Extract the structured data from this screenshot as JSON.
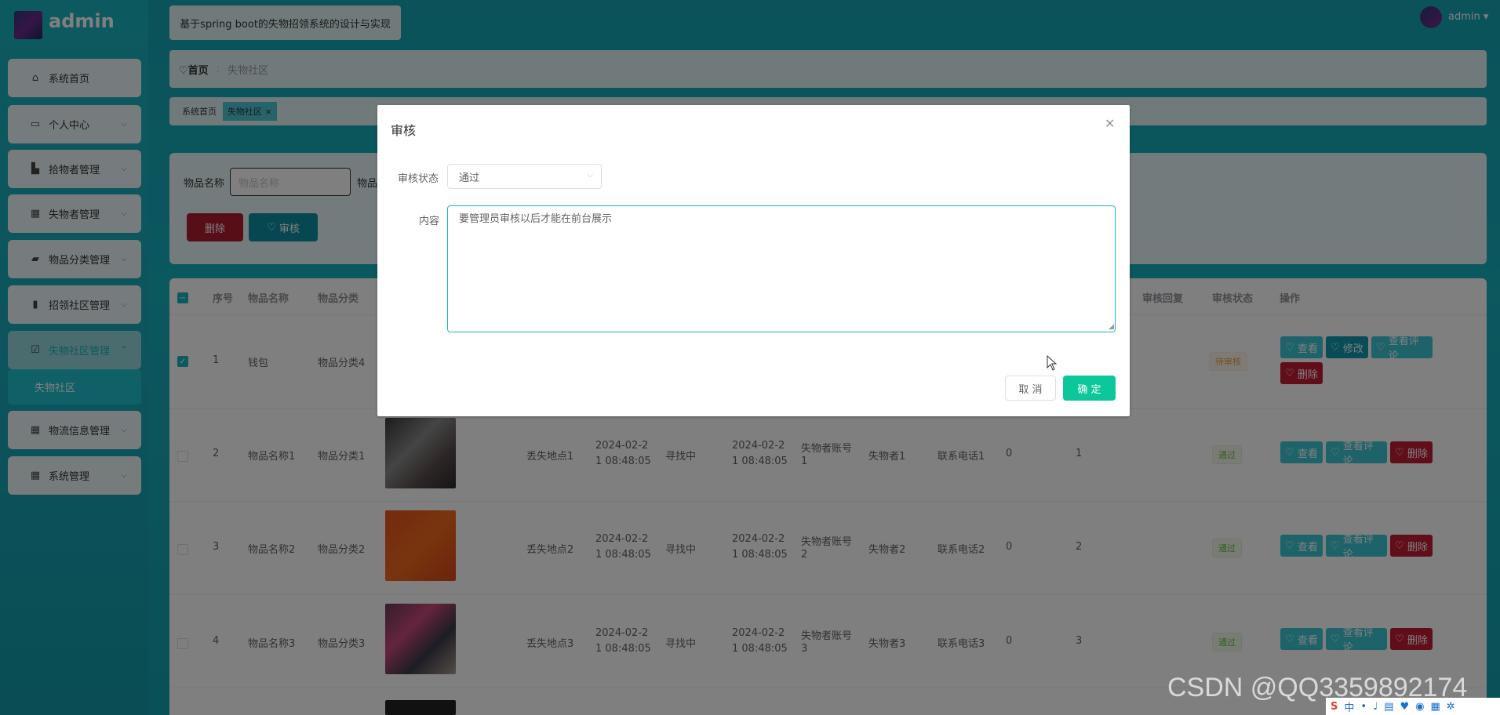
{
  "app": {
    "name": "admin",
    "title": "基于spring boot的失物招领系统的设计与实现",
    "user": "admin"
  },
  "sidebar": {
    "items": [
      {
        "label": "系统首页",
        "icon": "home-icon"
      },
      {
        "label": "个人中心",
        "icon": "profile-icon"
      },
      {
        "label": "拾物者管理",
        "icon": "finder-icon"
      },
      {
        "label": "失物者管理",
        "icon": "grid-icon"
      },
      {
        "label": "物品分类管理",
        "icon": "briefcase-icon"
      },
      {
        "label": "招领社区管理",
        "icon": "bar-chart-icon"
      },
      {
        "label": "失物社区管理",
        "icon": "checkbox-icon"
      },
      {
        "label": "物流信息管理",
        "icon": "grid-nine-icon"
      },
      {
        "label": "系统管理",
        "icon": "grid-icon"
      }
    ],
    "sub_item": "失物社区"
  },
  "breadcrumb": {
    "home": "首页",
    "current": "失物社区"
  },
  "tags": [
    "系统首页",
    "失物社区"
  ],
  "search": {
    "name_label": "物品名称",
    "name_placeholder": "物品名称",
    "category_label_partial": "物品"
  },
  "actions": {
    "delete": "删除",
    "audit": "审核"
  },
  "table": {
    "headers": {
      "index": "序号",
      "name": "物品名称",
      "category": "物品分类",
      "reply": "审核回复",
      "status": "审核状态",
      "ops": "操作"
    },
    "rows": [
      {
        "index": "1",
        "name": "钱包",
        "category": "物品分类4",
        "location": "",
        "date1": "",
        "state": "",
        "date2": "",
        "account": "",
        "owner": "",
        "phone": "",
        "c1": "",
        "c2": "",
        "status": "待审核",
        "checked": true
      },
      {
        "index": "2",
        "name": "物品名称1",
        "category": "物品分类1",
        "location": "丢失地点1",
        "date1a": "2024-02-2",
        "date1b": "1 08:48:05",
        "state": "寻找中",
        "date2a": "2024-02-2",
        "date2b": "1 08:48:05",
        "account_a": "失物者账号",
        "account_b": "1",
        "owner": "失物者1",
        "phone": "联系电话1",
        "c1": "0",
        "c2": "1",
        "status": "通过"
      },
      {
        "index": "3",
        "name": "物品名称2",
        "category": "物品分类2",
        "location": "丢失地点2",
        "date1a": "2024-02-2",
        "date1b": "1 08:48:05",
        "state": "寻找中",
        "date2a": "2024-02-2",
        "date2b": "1 08:48:05",
        "account_a": "失物者账号",
        "account_b": "2",
        "owner": "失物者2",
        "phone": "联系电话2",
        "c1": "0",
        "c2": "2",
        "status": "通过"
      },
      {
        "index": "4",
        "name": "物品名称3",
        "category": "物品分类3",
        "location": "丢失地点3",
        "date1a": "2024-02-2",
        "date1b": "1 08:48:05",
        "state": "寻找中",
        "date2a": "2024-02-2",
        "date2b": "1 08:48:05",
        "account_a": "失物者账号",
        "account_b": "3",
        "owner": "失物者3",
        "phone": "联系电话3",
        "c1": "0",
        "c2": "3",
        "status": "通过"
      }
    ],
    "op_labels": {
      "view": "查看",
      "edit": "修改",
      "comments": "查看评论",
      "delete": "删除"
    }
  },
  "dialog": {
    "title": "审核",
    "status_label": "审核状态",
    "status_value": "通过",
    "content_label": "内容",
    "content_value": "要管理员审核以后才能在前台展示",
    "cancel": "取 消",
    "confirm": "确 定"
  },
  "watermark": "CSDN @QQ3359892174",
  "tray": {
    "ime": "中"
  },
  "colors": {
    "accent": "#1bb3c0",
    "danger": "#c11d35",
    "confirm": "#0cc79a"
  }
}
